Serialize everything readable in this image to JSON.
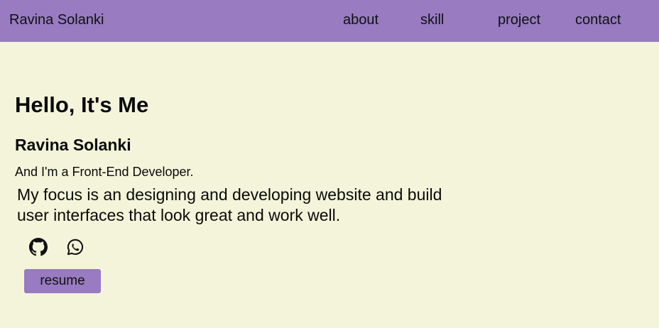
{
  "nav": {
    "brand": "Ravina Solanki",
    "links": [
      {
        "label": "about"
      },
      {
        "label": "skill"
      },
      {
        "label": "project"
      },
      {
        "label": "contact"
      }
    ]
  },
  "hero": {
    "greeting": "Hello, It's Me",
    "name": "Ravina Solanki",
    "role": "And I'm a Front-End Developer.",
    "focus": "My focus is an designing and developing website and build user interfaces that look great and work well.",
    "socials": [
      {
        "icon": "github-icon"
      },
      {
        "icon": "whatsapp-icon"
      }
    ],
    "resume_label": "resume"
  },
  "colors": {
    "background": "#f4f4da",
    "accent": "#987bc1",
    "text": "#111111"
  }
}
